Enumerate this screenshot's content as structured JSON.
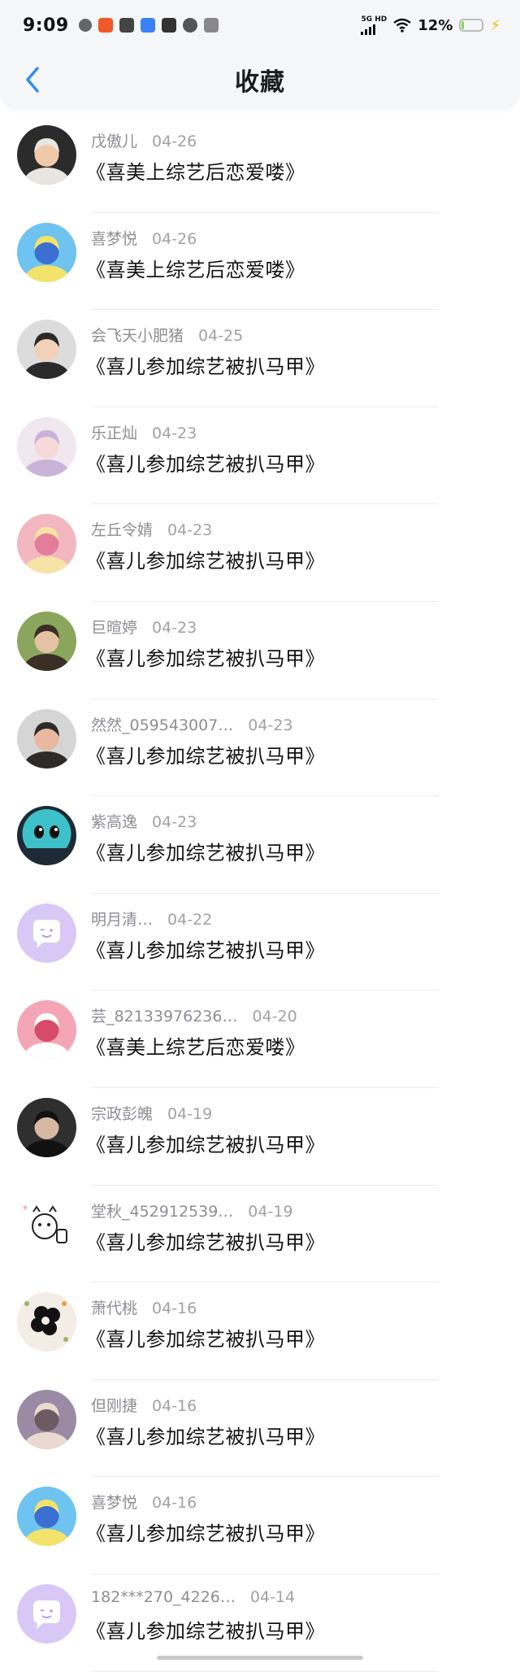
{
  "status_bar": {
    "time": "9:09",
    "network": "5G HD",
    "battery": "12%",
    "battery_level": 0.12
  },
  "header": {
    "title": "收藏",
    "back_icon": "chevron-left-icon",
    "accent_color": "#2f8cf0"
  },
  "items": [
    {
      "user": "戊傲儿",
      "date": "04-26",
      "title": "《喜美上综艺后恋爱喽》",
      "avatar": "avatar-photo"
    },
    {
      "user": "喜梦悦",
      "date": "04-26",
      "title": "《喜美上综艺后恋爱喽》",
      "avatar": "avatar-anime"
    },
    {
      "user": "会飞天小肥猪",
      "date": "04-25",
      "title": "《喜儿参加综艺被扒马甲》",
      "avatar": "avatar-photo"
    },
    {
      "user": "乐正灿",
      "date": "04-23",
      "title": "《喜儿参加综艺被扒马甲》",
      "avatar": "avatar-anime"
    },
    {
      "user": "左丘令婧",
      "date": "04-23",
      "title": "《喜儿参加综艺被扒马甲》",
      "avatar": "avatar-doll"
    },
    {
      "user": "巨暄婷",
      "date": "04-23",
      "title": "《喜儿参加综艺被扒马甲》",
      "avatar": "avatar-photo"
    },
    {
      "user": "然然_059543007…",
      "date": "04-23",
      "title": "《喜儿参加综艺被扒马甲》",
      "avatar": "avatar-photo"
    },
    {
      "user": "紫高逸",
      "date": "04-23",
      "title": "《喜儿参加综艺被扒马甲》",
      "avatar": "avatar-cartoon"
    },
    {
      "user": "明月清…",
      "date": "04-22",
      "title": "《喜儿参加综艺被扒马甲》",
      "avatar": "avatar-default"
    },
    {
      "user": "芸_82133976236…",
      "date": "04-20",
      "title": "《喜美上综艺后恋爱喽》",
      "avatar": "avatar-anime"
    },
    {
      "user": "宗政彭魄",
      "date": "04-19",
      "title": "《喜儿参加综艺被扒马甲》",
      "avatar": "avatar-photo"
    },
    {
      "user": "堂秋_452912539…",
      "date": "04-19",
      "title": "《喜儿参加综艺被扒马甲》",
      "avatar": "avatar-sketch"
    },
    {
      "user": "萧代桃",
      "date": "04-16",
      "title": "《喜儿参加综艺被扒马甲》",
      "avatar": "avatar-flower"
    },
    {
      "user": "但刚捷",
      "date": "04-16",
      "title": "《喜儿参加综艺被扒马甲》",
      "avatar": "avatar-photo"
    },
    {
      "user": "喜梦悦",
      "date": "04-16",
      "title": "《喜儿参加综艺被扒马甲》",
      "avatar": "avatar-anime"
    },
    {
      "user": "182***270_4226…",
      "date": "04-14",
      "title": "《喜儿参加综艺被扒马甲》",
      "avatar": "avatar-default"
    }
  ]
}
